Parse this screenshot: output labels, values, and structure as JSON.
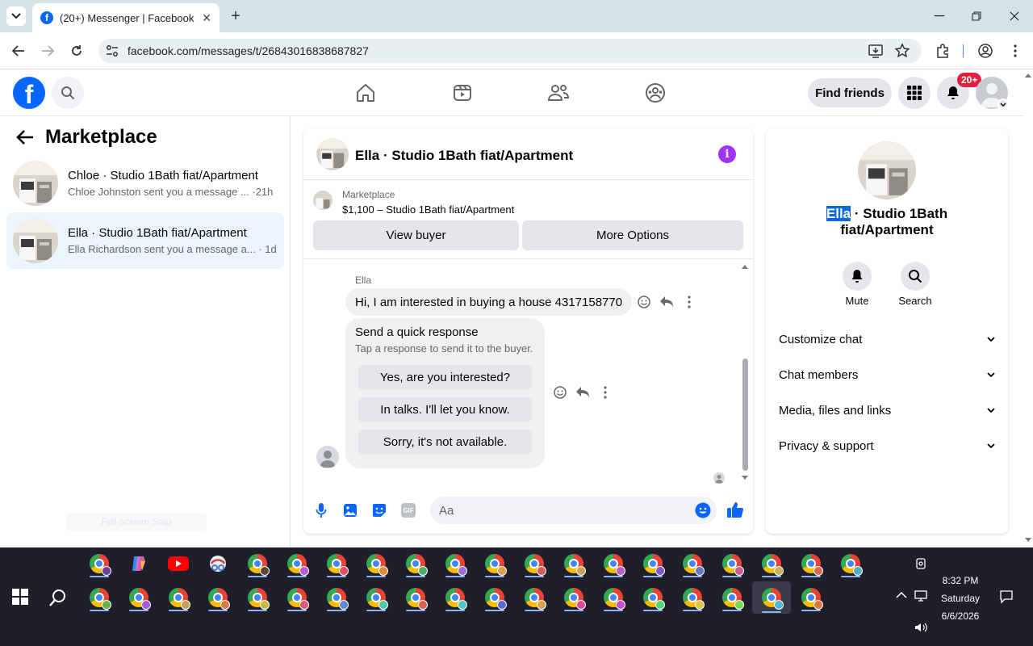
{
  "browser": {
    "tab_title": "(20+) Messenger | Facebook",
    "url": "facebook.com/messages/t/26843016838687827",
    "tab_close": "✕",
    "new_tab": "+"
  },
  "fb": {
    "find_friends": "Find friends",
    "notif_badge": "20+",
    "logo_letter": "f"
  },
  "left": {
    "title": "Marketplace",
    "conversations": [
      {
        "name": "Chloe · Studio 1Bath fiat/Apartment",
        "preview": "Chloe Johnston sent you a message ...",
        "time": "·21h"
      },
      {
        "name": "Ella · Studio 1Bath fiat/Apartment",
        "preview": "Ella Richardson sent you a message a...",
        "time": "· 1d"
      }
    ],
    "faint_label": "Full-screen Snip"
  },
  "chat": {
    "title": "Ella · Studio 1Bath fiat/Apartment",
    "listing_label": "Marketplace",
    "listing_price": "$1,100 – Studio 1Bath fiat/Apartment",
    "view_buyer": "View buyer",
    "more_options": "More Options",
    "sender_name": "Ella",
    "message": "Hi, I am interested in buying a house 4317158770",
    "quick_title": "Send a quick response",
    "quick_sub": "Tap a response to send it to the buyer.",
    "quick_options": [
      "Yes, are you interested?",
      "In talks. I'll let you know.",
      "Sorry, it's not available."
    ],
    "composer_placeholder": "Aa",
    "gif_label": "GIF",
    "info_glyph": "i"
  },
  "right": {
    "name_highlight": "Ella",
    "name_rest": " · Studio 1Bath fiat/Apartment",
    "mute": "Mute",
    "search": "Search",
    "sections": [
      "Customize chat",
      "Chat members",
      "Media, files and links",
      "Privacy & support"
    ]
  },
  "taskbar": {
    "time": "8:32 PM",
    "day": "Saturday",
    "date": "6/6/2026"
  },
  "colors": {
    "fb_blue": "#0866ff",
    "badge_red": "#e41e3f",
    "info_purple": "#a033ff",
    "selected_conv": "#ebf5ff",
    "taskbar": "#1f1f2b"
  }
}
